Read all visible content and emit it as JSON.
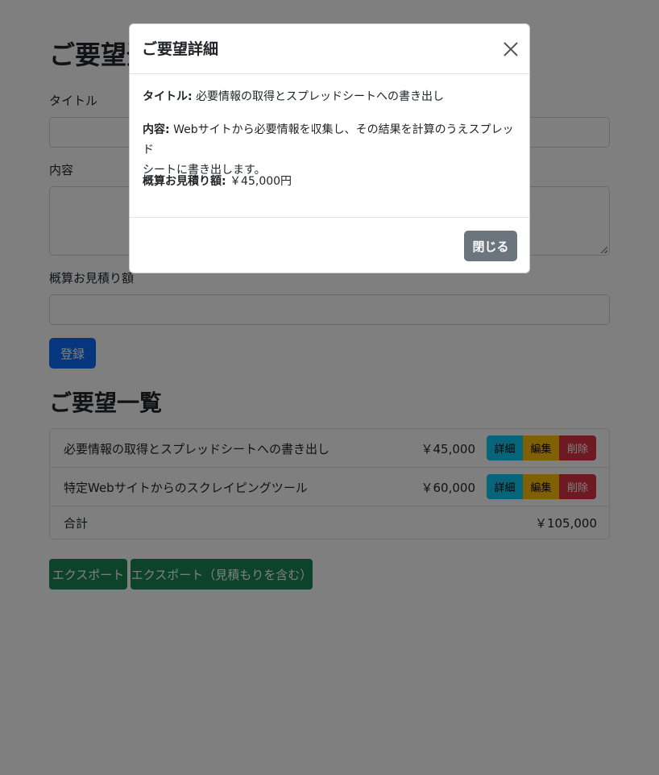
{
  "form": {
    "heading": "ご要望登録",
    "title_label": "タイトル",
    "title_value": "",
    "content_label": "内容",
    "content_value": "",
    "estimate_label": "概算お見積り額",
    "estimate_value": "",
    "submit_label": "登録"
  },
  "list": {
    "heading": "ご要望一覧",
    "rows": [
      {
        "title": "必要情報の取得とスプレッドシートへの書き出し",
        "price": "￥45,000",
        "detail": "詳細",
        "edit": "編集",
        "delete": "削除"
      },
      {
        "title": "特定Webサイトからのスクレイピングツール",
        "price": "￥60,000",
        "detail": "詳細",
        "edit": "編集",
        "delete": "削除"
      }
    ],
    "total_label": "合計",
    "total_value": "￥105,000"
  },
  "export": {
    "export_label": "エクスポート",
    "export_with_estimate_label": "エクスポート（見積もりを含む）"
  },
  "modal": {
    "title": "ご要望詳細",
    "title_key": "タイトル:",
    "title_text": "必要情報の取得とスプレッドシートへの書き出し",
    "content_key": "内容:",
    "content_text_1": "Webサイトから必要情報を収集し、その結果を計算のうえスプレッド",
    "content_text_2": "シートに書き出します。",
    "estimate_key": "概算お見積り額:",
    "estimate_text": "￥45,000円",
    "close_label": "閉じる",
    "close_icon": "close-icon"
  },
  "colors": {
    "primary": "#0d6efd",
    "info": "#0dcaf0",
    "warning": "#ffc107",
    "danger": "#dc3545",
    "success": "#198754",
    "secondary": "#6c757d"
  }
}
